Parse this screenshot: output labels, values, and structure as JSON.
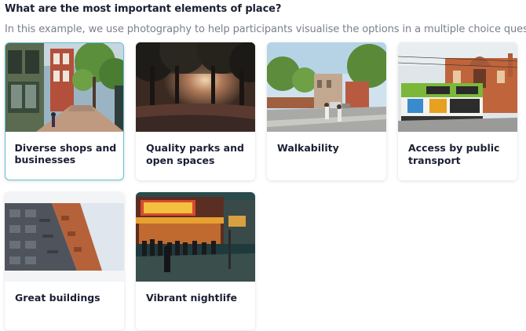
{
  "question": {
    "title": "What are the most important elements of place?",
    "subtitle": "In this example, we use photography to help participants visualise the options in a multiple choice question."
  },
  "options": [
    {
      "label": "Diverse shops and businesses",
      "selected": true,
      "image": "street-shops-photo"
    },
    {
      "label": "Quality parks and open spaces",
      "selected": false,
      "image": "park-trees-photo"
    },
    {
      "label": "Walkability",
      "selected": false,
      "image": "pedestrians-street-photo"
    },
    {
      "label": "Access by public transport",
      "selected": false,
      "image": "tram-station-photo"
    },
    {
      "label": "Great buildings",
      "selected": false,
      "image": "apartment-building-photo"
    },
    {
      "label": "Vibrant nightlife",
      "selected": false,
      "image": "night-street-photo"
    }
  ],
  "colors": {
    "selected_border": "#5fc0d6",
    "title_text": "#1b1f33",
    "subtitle_text": "#7a7f8c"
  }
}
